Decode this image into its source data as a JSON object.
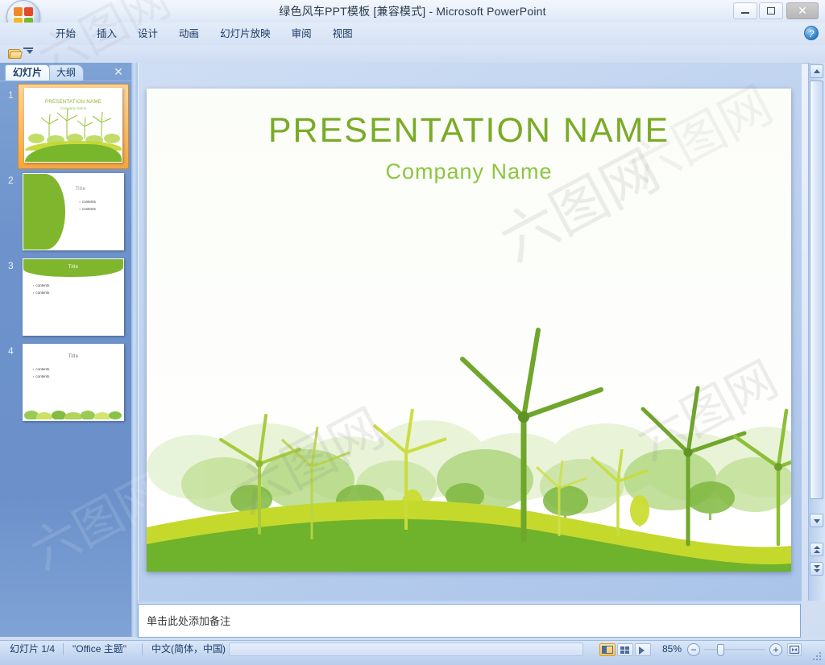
{
  "window": {
    "title": "绿色风车PPT模板 [兼容模式] - Microsoft PowerPoint",
    "minimize_label": "",
    "maximize_label": "",
    "close_label": "✕"
  },
  "office_button": {
    "name": "office-orb"
  },
  "menu": {
    "items": [
      {
        "label": "开始"
      },
      {
        "label": "插入"
      },
      {
        "label": "设计"
      },
      {
        "label": "动画"
      },
      {
        "label": "幻灯片放映"
      },
      {
        "label": "审阅"
      },
      {
        "label": "视图"
      }
    ],
    "help_label": "?"
  },
  "quick_access": {
    "open_icon": "open-folder-icon",
    "dropdown_icon": "customize-dropdown-icon"
  },
  "left_pane": {
    "tabs": [
      {
        "label": "幻灯片",
        "selected": true
      },
      {
        "label": "大纲",
        "selected": false
      }
    ],
    "close_label": "✕",
    "thumbnails": [
      {
        "number": "1",
        "selected": true,
        "layout": "title",
        "title": "PRESENTATION  NAME",
        "subtitle": "Company Name"
      },
      {
        "number": "2",
        "selected": false,
        "layout": "left-green-panel",
        "title": "Title",
        "bullets": [
          "contents",
          "contents"
        ]
      },
      {
        "number": "3",
        "selected": false,
        "layout": "green-header-band",
        "title": "Title",
        "bullets": [
          "contents",
          "contents"
        ]
      },
      {
        "number": "4",
        "selected": false,
        "layout": "trees-footer",
        "title": "Title",
        "bullets": [
          "contents",
          "contents"
        ]
      }
    ]
  },
  "slide": {
    "title": "PRESENTATION  NAME",
    "subtitle": "Company Name",
    "colors": {
      "title": "#7aab28",
      "subtitle": "#8cc63f",
      "hill_green": "#6fb22c",
      "hill_yellow": "#c5d92c",
      "turbine": "#6fa62b",
      "turbine_light": "#c3d831"
    }
  },
  "notes": {
    "placeholder": "单击此处添加备注"
  },
  "scrollbar": {
    "up_icon": "scroll-up-icon",
    "down_icon": "scroll-down-icon",
    "prev_slide_icon": "previous-slide-icon",
    "next_slide_icon": "next-slide-icon"
  },
  "status_bar": {
    "slide_counter": "幻灯片 1/4",
    "theme": "\"Office 主题\"",
    "language": "中文(简体，中国)",
    "zoom_level": "85%",
    "zoom_out_label": "−",
    "zoom_in_label": "+",
    "views": [
      {
        "name": "normal",
        "selected": true
      },
      {
        "name": "slide-sorter",
        "selected": false
      },
      {
        "name": "slide-show",
        "selected": false
      }
    ],
    "fit_button": "fit-slide-to-window"
  },
  "watermark": {
    "text": "六图网"
  }
}
